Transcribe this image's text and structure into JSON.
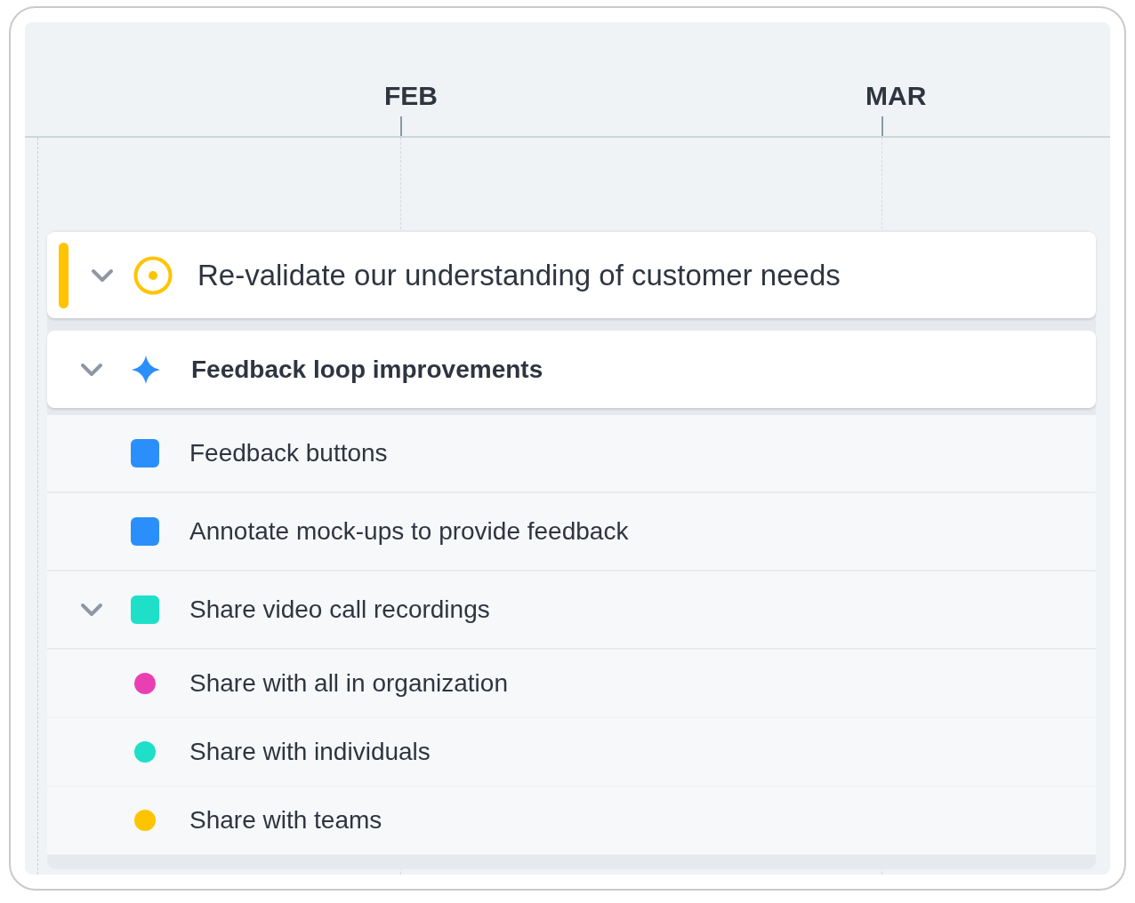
{
  "timeline": {
    "months": [
      {
        "label": "FEB"
      },
      {
        "label": "MAR"
      }
    ]
  },
  "items": [
    {
      "kind": "goal",
      "title": "Re-validate our understanding of customer needs",
      "expanded": true,
      "color": "#ffc400"
    },
    {
      "kind": "epic",
      "title": "Feedback loop improvements",
      "expanded": true,
      "color": "#2b8ffb"
    },
    {
      "kind": "feature",
      "title": "Feedback buttons",
      "color": "#2b8ffb"
    },
    {
      "kind": "feature",
      "title": "Annotate mock-ups to provide feedback",
      "color": "#2b8ffb"
    },
    {
      "kind": "feature",
      "title": "Share video call recordings",
      "expanded": true,
      "color": "#1ee0c8"
    },
    {
      "kind": "subtask",
      "title": "Share with all in organization",
      "color": "#ea3fb3"
    },
    {
      "kind": "subtask",
      "title": "Share with individuals",
      "color": "#1ee0c8"
    },
    {
      "kind": "subtask",
      "title": "Share with teams",
      "color": "#ffc400"
    }
  ]
}
